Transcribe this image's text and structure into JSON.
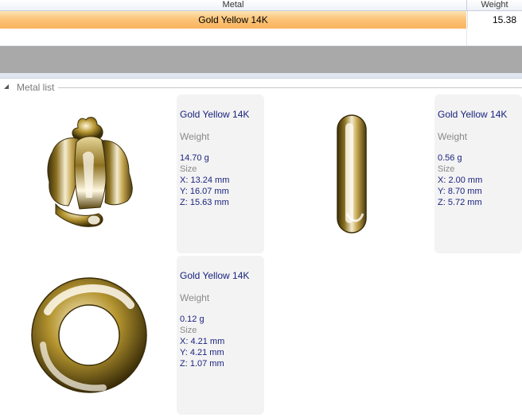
{
  "grid": {
    "columns": {
      "metal": "Metal",
      "weight": "Weight"
    },
    "rows": [
      {
        "metal": "Gold Yellow 14K",
        "weight": "15.38"
      }
    ]
  },
  "section": {
    "title": "Metal list"
  },
  "items": [
    {
      "metal": "Gold Yellow 14K",
      "weight_label": "Weight",
      "weight": "14.70 g",
      "size_label": "Size",
      "x": "X: 13.24 mm",
      "y": "Y: 16.07 mm",
      "z": "Z: 15.63 mm",
      "thumbnail": "rose-pendant-icon"
    },
    {
      "metal": "Gold Yellow 14K",
      "weight_label": "Weight",
      "weight": "0.56 g",
      "size_label": "Size",
      "x": "X: 2.00 mm",
      "y": "Y: 8.70 mm",
      "z": "Z: 5.72 mm",
      "thumbnail": "bail-ring-icon"
    },
    {
      "metal": "Gold Yellow 14K",
      "weight_label": "Weight",
      "weight": "0.12 g",
      "size_label": "Size",
      "x": "X: 4.21 mm",
      "y": "Y: 4.21 mm",
      "z": "Z: 1.07 mm",
      "thumbnail": "jump-ring-icon"
    }
  ],
  "colors": {
    "selected_row": "#f9b45d",
    "gray_bar": "#a9a9a9",
    "info_text": "#1a237e",
    "label_text": "#8a8a8a",
    "gold": "#b8962e"
  }
}
